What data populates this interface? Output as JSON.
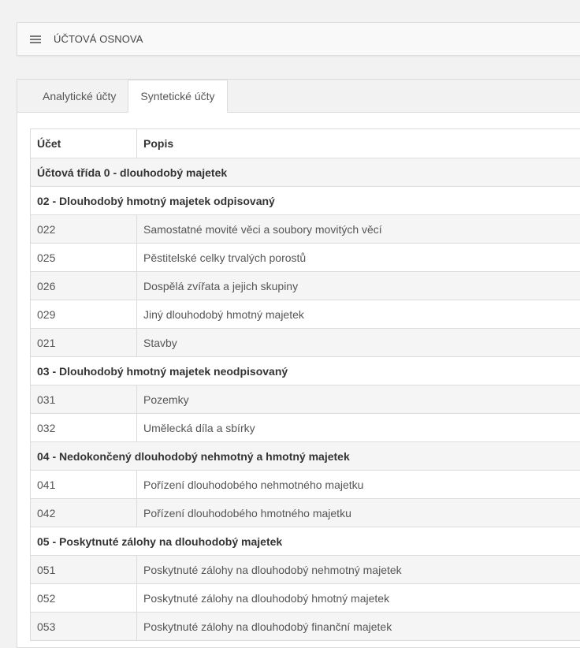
{
  "header": {
    "title": "ÚČTOVÁ OSNOVA",
    "icon": "menu-icon"
  },
  "tabs": [
    {
      "label": "Analytické účty",
      "active": false
    },
    {
      "label": "Syntetické účty",
      "active": true
    }
  ],
  "table": {
    "columns": [
      "Účet",
      "Popis"
    ],
    "rows": [
      {
        "type": "group",
        "label": "Účtová třída 0 - dlouhodobý majetek"
      },
      {
        "type": "group",
        "label": "02 - Dlouhodobý hmotný majetek odpisovaný"
      },
      {
        "type": "row",
        "code": "022",
        "desc": "Samostatné movité věci a soubory movitých věcí"
      },
      {
        "type": "row",
        "code": "025",
        "desc": "Pěstitelské celky trvalých porostů"
      },
      {
        "type": "row",
        "code": "026",
        "desc": "Dospělá zvířata a jejich skupiny"
      },
      {
        "type": "row",
        "code": "029",
        "desc": "Jiný dlouhodobý hmotný majetek"
      },
      {
        "type": "row",
        "code": "021",
        "desc": "Stavby"
      },
      {
        "type": "group",
        "label": "03 - Dlouhodobý hmotný majetek neodpisovaný"
      },
      {
        "type": "row",
        "code": "031",
        "desc": "Pozemky"
      },
      {
        "type": "row",
        "code": "032",
        "desc": "Umělecká díla a sbírky"
      },
      {
        "type": "group",
        "label": "04 - Nedokončený dlouhodobý nehmotný a hmotný majetek"
      },
      {
        "type": "row",
        "code": "041",
        "desc": "Pořízení dlouhodobého nehmotného majetku"
      },
      {
        "type": "row",
        "code": "042",
        "desc": "Pořízení dlouhodobého hmotného majetku"
      },
      {
        "type": "group",
        "label": "05 - Poskytnuté zálohy na dlouhodobý majetek"
      },
      {
        "type": "row",
        "code": "051",
        "desc": "Poskytnuté zálohy na dlouhodobý nehmotný majetek"
      },
      {
        "type": "row",
        "code": "052",
        "desc": "Poskytnuté zálohy na dlouhodobý hmotný majetek"
      },
      {
        "type": "row",
        "code": "053",
        "desc": "Poskytnuté zálohy na dlouhodobý finanční majetek"
      }
    ]
  }
}
